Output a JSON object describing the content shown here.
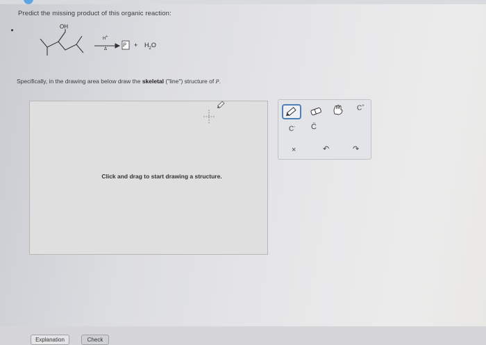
{
  "question": {
    "prompt": "Predict the missing product of this organic reaction:"
  },
  "reaction": {
    "reactant_group_label": "OH",
    "reagent_top": "H",
    "reagent_top_sup": "+",
    "reagent_bottom": "Δ",
    "product_placeholder": "P",
    "plus": "+",
    "byproduct": "H",
    "byproduct_sub": "2",
    "byproduct_tail": "O"
  },
  "instruction": {
    "prefix": "Specifically, in the drawing area below draw the ",
    "emphasis": "skeletal",
    "middle": " (\"line\") structure of ",
    "symbol": "P",
    "suffix": "."
  },
  "canvas": {
    "hint": "Click and drag to start drawing a structure."
  },
  "toolbox": {
    "charge_minus": "C",
    "charge_minus_sup": "-",
    "lone_pair": "C̈",
    "charge_plus": "C",
    "charge_plus_sup": "+",
    "erase": "×",
    "undo": "↶",
    "redo": "↷"
  },
  "footer": {
    "explanation_label": "Explanation",
    "check_label": "Check"
  },
  "colors": {
    "accent": "#4d7fb8",
    "tab_chevron": "#5aa6e0"
  }
}
